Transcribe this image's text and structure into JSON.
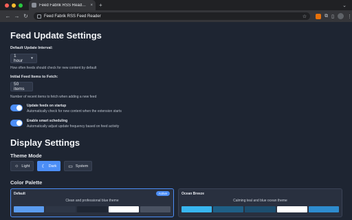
{
  "browser": {
    "tab_title": "Feed Fabrik RSS Reader Settings",
    "tab_close": "×",
    "new_tab": "+",
    "url_text": "Feed Fabrik RSS Feed Reader",
    "colors": {
      "tabbar": "#202124",
      "toolbar": "#35363a",
      "close": "#ff5f57",
      "minimize": "#febc2e",
      "maximize": "#28c840"
    }
  },
  "feed_settings": {
    "title": "Feed Update Settings",
    "update_interval": {
      "label": "Default Update Interval:",
      "value": "1 hour",
      "help": "How often feeds should check for new content by default"
    },
    "initial_items": {
      "label": "Initial Feed Items to Fetch:",
      "value": "50 items",
      "help": "Number of recent items to fetch when adding a new feed"
    },
    "toggles": [
      {
        "title": "Update feeds on startup",
        "desc": "Automatically check for new content when the extension starts",
        "on": true
      },
      {
        "title": "Enable smart scheduling",
        "desc": "Automatically adjust update frequency based on feed activity",
        "on": true
      }
    ]
  },
  "display_settings": {
    "title": "Display Settings",
    "theme_mode": {
      "label": "Theme Mode",
      "options": [
        {
          "label": "Light",
          "icon": "sun-icon",
          "glyph": "☼",
          "active": false
        },
        {
          "label": "Dark",
          "icon": "moon-icon",
          "glyph": "☾",
          "active": true
        },
        {
          "label": "System",
          "icon": "monitor-icon",
          "glyph": "▭",
          "active": false
        }
      ]
    },
    "color_palette": {
      "label": "Color Palette",
      "palettes": [
        {
          "name": "Default",
          "desc": "Clean and professional blue theme",
          "badge": "Active",
          "active": true,
          "swatches": [
            "#5b9cf0",
            "#2e3646",
            "#1f2633",
            "#ffffff",
            "#4a5262"
          ]
        },
        {
          "name": "Ocean Breeze",
          "desc": "Calming teal and blue ocean theme",
          "active": false,
          "swatches": [
            "#38b6f0",
            "#1f5f86",
            "#1d4e6f",
            "#ffffff",
            "#2e8ccf"
          ]
        }
      ]
    }
  }
}
